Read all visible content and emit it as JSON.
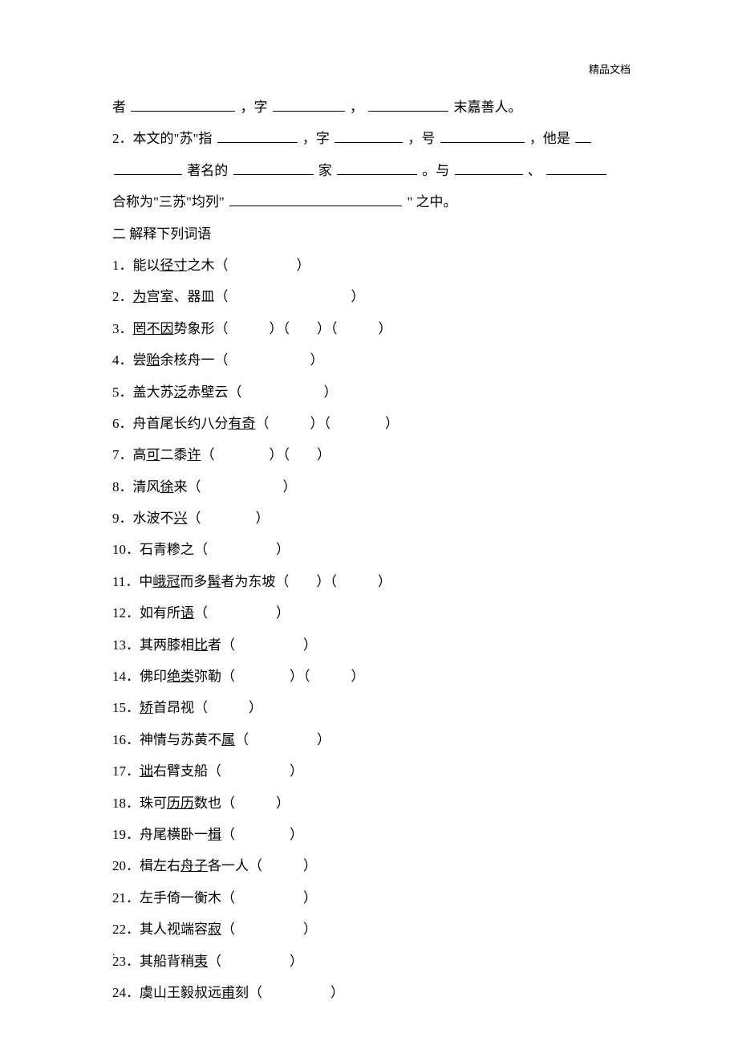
{
  "header": "精品文档",
  "intro": {
    "line1_prefix": "者",
    "line1_mid1": "，字",
    "line1_mid2": "，",
    "line1_suffix": "末嘉善人。",
    "line2_prefix": "2．本文的\"苏\"指 ",
    "line2_mid1": "，字",
    "line2_mid2": "，号",
    "line2_suffix": "，他是",
    "line3_mid1": "著名的",
    "line3_mid2": "家",
    "line3_mid3": "。与",
    "line3_mid4": "、",
    "line4_prefix": "合称为\"三苏\"均列\" ",
    "line4_suffix": "\" 之中。"
  },
  "section2_title": "二 解释下列词语",
  "items": [
    {
      "num": "1．",
      "text_before": "能以",
      "underlined": "径寸",
      "text_after": "之木（　　　　　）"
    },
    {
      "num": "2．",
      "text_before": "",
      "underlined": "为",
      "text_after": "宫室、器皿（　　　　　　　　　）"
    },
    {
      "num": "3．",
      "text_before": "",
      "underlined": "罔不因",
      "text_after": "势象形（　　　）（　　）（　　　）"
    },
    {
      "num": "4．",
      "text_before": "尝",
      "underlined": "贻",
      "text_after": "余核舟一（　　　　　　）"
    },
    {
      "num": "5．",
      "text_before": "盖大苏",
      "underlined": "泛",
      "text_after": "赤壁云（　　　　　　）"
    },
    {
      "num": "6．",
      "text_before": "舟首尾长约八分",
      "underlined": "有奇",
      "text_after": "（　　　）（　　　　）"
    },
    {
      "num": "7．",
      "text_before": "高",
      "underlined": "可",
      "text_mid": "二黍",
      "underlined2": "许",
      "text_after": "（　　　　）（　　）"
    },
    {
      "num": "8．",
      "text_before": "清风",
      "underlined": "徐",
      "text_after": "来（　　　　　　）"
    },
    {
      "num": "9．",
      "text_before": "水波不",
      "underlined": "兴",
      "text_after": "（　　　　）"
    },
    {
      "num": "10．",
      "text_before": "石青糁之（　　　　　）",
      "underlined": "",
      "text_after": ""
    },
    {
      "num": "11．",
      "text_before": "中",
      "underlined": "峨冠",
      "text_mid": "而多",
      "underlined2": "髯",
      "text_after": "者为东坡（　　）（　　　）"
    },
    {
      "num": "12．",
      "text_before": "如有所",
      "underlined": "语",
      "text_after": "（　　　　　）"
    },
    {
      "num": "13．",
      "text_before": "其两膝相",
      "underlined": "比",
      "text_after": "者（　　　　　）"
    },
    {
      "num": "14．",
      "text_before": "佛印",
      "underlined": "绝类",
      "text_after": "弥勒（　　　　）（　　　）"
    },
    {
      "num": "15．",
      "text_before": "",
      "underlined": "矫",
      "text_after": "首昂视（　　　）"
    },
    {
      "num": "16．",
      "text_before": "神情与苏黄不",
      "underlined": "属",
      "text_after": "（　　　　　）"
    },
    {
      "num": "17．",
      "text_before": "",
      "underlined": "诎",
      "text_after": "右臂支船（　　　　　）"
    },
    {
      "num": "18．",
      "text_before": "珠可",
      "underlined": "历历",
      "text_after": "数也（　　　）"
    },
    {
      "num": "19．",
      "text_before": "舟尾横卧一",
      "underlined": "楫",
      "text_after": "（　　　　）"
    },
    {
      "num": "20．",
      "text_before": "楫左右",
      "underlined": "舟子",
      "text_after": "各一人（　　　）"
    },
    {
      "num": "21．",
      "text_before": "左手倚一衡木（　　　　　）",
      "underlined": "",
      "text_after": ""
    },
    {
      "num": "22．",
      "text_before": "其人视端容",
      "underlined": "寂",
      "text_after": "（　　　　　）"
    },
    {
      "num": "23．",
      "text_before": "其船背稍",
      "underlined": "夷",
      "text_after": "（　　　　　）"
    },
    {
      "num": "24．",
      "text_before": "虞山王毅叔远",
      "underlined": "甫",
      "text_after": "刻（　　　　　）"
    }
  ],
  "footer_dot": "."
}
